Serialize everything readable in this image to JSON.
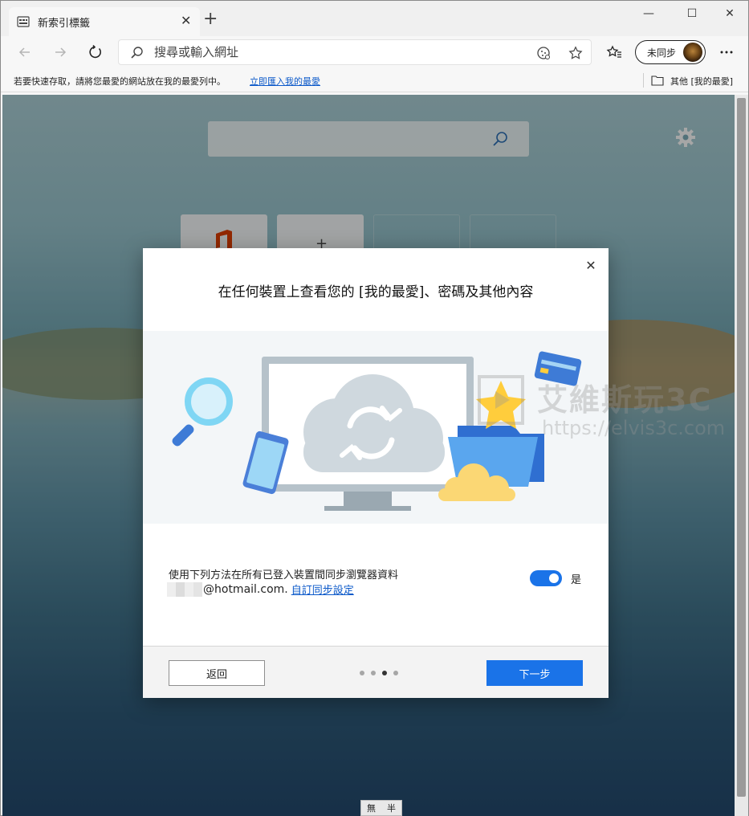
{
  "tab": {
    "title": "新索引標籤"
  },
  "address_bar": {
    "placeholder": "搜尋或輸入網址"
  },
  "profile": {
    "label": "未同步"
  },
  "favorites_bar": {
    "prompt": "若要快速存取，請將您最愛的網站放在我的最愛列中。",
    "import_link": "立即匯入我的最愛",
    "other_folder": "其他 [我的最愛]"
  },
  "dialog": {
    "title": "在任何裝置上查看您的 [我的最愛]、密碼及其他內容",
    "description": "使用下列方法在所有已登入裝置間同步瀏覽器資料",
    "email_suffix": "@hotmail.com.",
    "customize_link": "自訂同步設定",
    "toggle_label": "是",
    "toggle_on": true,
    "back_button": "返回",
    "next_button": "下一步",
    "step_current": 3,
    "step_total": 4
  },
  "ime": {
    "mode1": "無",
    "mode2": "半"
  },
  "watermark": {
    "title": "艾維斯玩3C",
    "url": "https://elvis3c.com"
  },
  "colors": {
    "accent": "#1a73e8",
    "link": "#0a58c9"
  }
}
